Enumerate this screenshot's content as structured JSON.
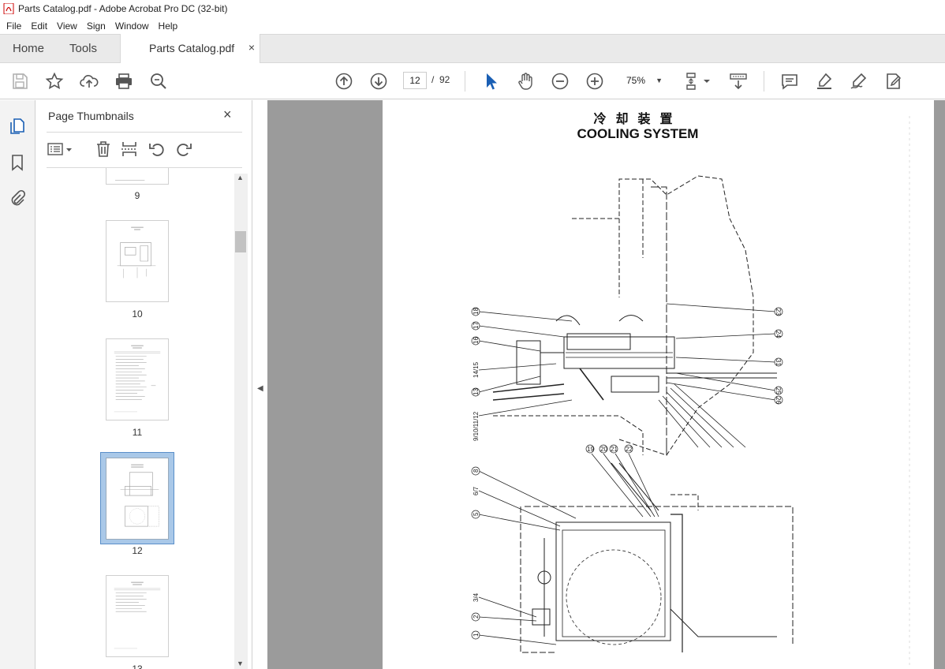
{
  "window": {
    "title": "Parts Catalog.pdf - Adobe Acrobat Pro DC (32-bit)"
  },
  "menu": [
    "File",
    "Edit",
    "View",
    "Sign",
    "Window",
    "Help"
  ],
  "tabs": {
    "home": "Home",
    "tools": "Tools",
    "document": "Parts Catalog.pdf",
    "close": "×"
  },
  "toolbar": {
    "current_page": "12",
    "page_separator": "/",
    "total_pages": "92",
    "zoom": "75%",
    "icons": [
      "save-icon",
      "bookmark-star-icon",
      "upload-icon",
      "print-icon",
      "search-zoom-icon",
      "page-up-icon",
      "page-down-icon",
      "select-cursor-icon",
      "hand-icon",
      "zoom-out-icon",
      "zoom-in-icon",
      "page-fit-icon",
      "scroll-mode-icon",
      "comment-icon",
      "highlight-icon",
      "sign-icon",
      "edit-pdf-icon"
    ]
  },
  "left_rail": {
    "icons": [
      "page-thumbnails-icon",
      "bookmarks-icon",
      "attachments-icon"
    ]
  },
  "thumbnail_panel": {
    "title": "Page Thumbnails",
    "close": "×",
    "thumbnails": [
      {
        "label": "9",
        "selected": false
      },
      {
        "label": "10",
        "selected": false
      },
      {
        "label": "11",
        "selected": false
      },
      {
        "label": "12",
        "selected": true
      },
      {
        "label": "13",
        "selected": false
      }
    ]
  },
  "document": {
    "heading_cn": "冷却装置",
    "heading_en": "COOLING SYSTEM",
    "callouts_upper_left": [
      "18",
      "17",
      "16",
      "14/15",
      "13",
      "9/10/11/12"
    ],
    "callouts_upper_right": [
      "23",
      "24",
      "31",
      "25",
      "26"
    ],
    "callouts_lower": [
      "19",
      "20",
      "21",
      "22",
      "8",
      "6/7",
      "5",
      "3/4",
      "2",
      "1"
    ]
  }
}
